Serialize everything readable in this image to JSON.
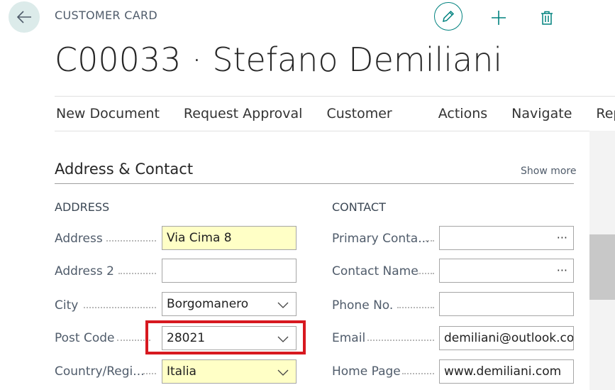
{
  "header": {
    "page_kind": "CUSTOMER CARD",
    "title": "C00033 · Stefano Demiliani"
  },
  "icons": {
    "back": "arrow-left-icon",
    "edit": "pencil-icon",
    "new": "plus-icon",
    "delete": "trash-icon",
    "dropdown": "chevron-down-icon",
    "lookup": "ellipsis-icon"
  },
  "colors": {
    "accent": "#00827f",
    "mandatory_field": "#ffffc6",
    "highlight_border": "#d71920"
  },
  "action_bar": {
    "items": [
      "New Document",
      "Request Approval",
      "Customer",
      "Actions",
      "Navigate",
      "Report"
    ]
  },
  "section": {
    "title": "Address & Contact",
    "show_more": "Show more"
  },
  "address": {
    "caption": "ADDRESS",
    "fields": [
      {
        "label": "Address",
        "value": "Via Cima 8",
        "mandatory": true,
        "type": "text"
      },
      {
        "label": "Address 2",
        "value": "",
        "mandatory": false,
        "type": "text"
      },
      {
        "label": "City",
        "value": "Borgomanero",
        "mandatory": false,
        "type": "dropdown"
      },
      {
        "label": "Post Code",
        "value": "28021",
        "mandatory": false,
        "type": "dropdown",
        "highlighted": true
      },
      {
        "label": "Country/Regi...",
        "value": "Italia",
        "mandatory": true,
        "type": "dropdown"
      }
    ]
  },
  "contact": {
    "caption": "CONTACT",
    "fields": [
      {
        "label": "Primary Conta...",
        "value": "",
        "type": "lookup",
        "lookup_symbol": "···"
      },
      {
        "label": "Contact Name",
        "value": "",
        "type": "lookup",
        "lookup_symbol": "···"
      },
      {
        "label": "Phone No.",
        "value": "",
        "type": "text"
      },
      {
        "label": "Email",
        "value": "demiliani@outlook.com",
        "type": "text"
      },
      {
        "label": "Home Page",
        "value": "www.demiliani.com",
        "type": "text"
      }
    ]
  }
}
